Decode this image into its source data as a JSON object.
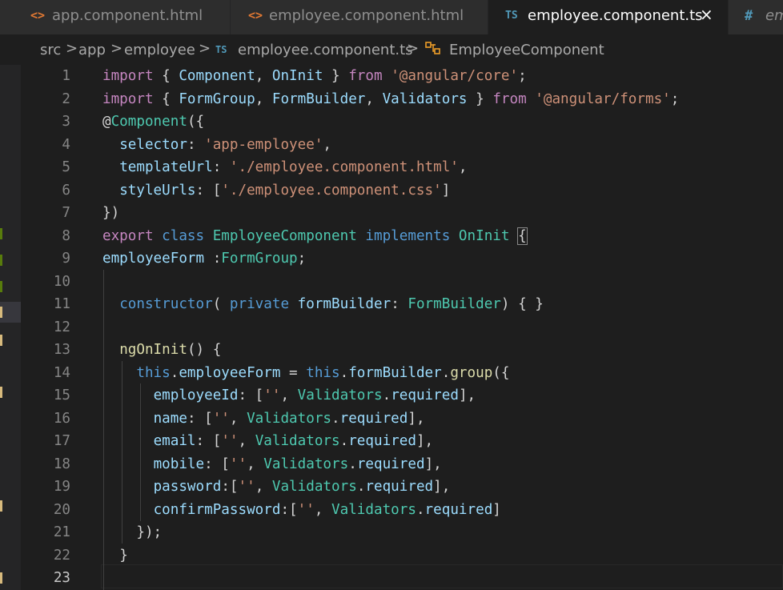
{
  "tabs": [
    {
      "icon": "<>",
      "label": "app.component.html",
      "active": false
    },
    {
      "icon": "<>",
      "label": "employee.component.html",
      "active": false
    },
    {
      "icon": "TS",
      "label": "employee.component.ts",
      "active": true,
      "close": "×"
    },
    {
      "icon": "#",
      "label": "em",
      "active": false
    }
  ],
  "breadcrumb": {
    "items": [
      "src",
      "app",
      "employee",
      "employee.component.ts",
      "EmployeeComponent"
    ],
    "file_icon": "TS",
    "separator": ">"
  },
  "editor": {
    "line_numbers": [
      "1",
      "2",
      "3",
      "4",
      "5",
      "6",
      "7",
      "8",
      "9",
      "10",
      "11",
      "12",
      "13",
      "14",
      "15",
      "16",
      "17",
      "18",
      "19",
      "20",
      "21",
      "22",
      "23"
    ],
    "current_line": "23",
    "code": {
      "l1": [
        "import",
        " { ",
        "Component",
        ", ",
        "OnInit",
        " } ",
        "from",
        " ",
        "'@angular/core'",
        ";"
      ],
      "l2": [
        "import",
        " { ",
        "FormGroup",
        ", ",
        "FormBuilder",
        ", ",
        "Validators",
        " } ",
        "from",
        " ",
        "'@angular/forms'",
        ";"
      ],
      "l3": [
        "@",
        "Component",
        "({"
      ],
      "l4": [
        "  ",
        "selector",
        ": ",
        "'app-employee'",
        ","
      ],
      "l5": [
        "  ",
        "templateUrl",
        ": ",
        "'./employee.component.html'",
        ","
      ],
      "l6": [
        "  ",
        "styleUrls",
        ": [",
        "'./employee.component.css'",
        "]"
      ],
      "l7": [
        "})"
      ],
      "l8": [
        "export",
        " ",
        "class",
        " ",
        "EmployeeComponent",
        " ",
        "implements",
        " ",
        "OnInit",
        " ",
        "{"
      ],
      "l9": [
        "employeeForm",
        " :",
        "FormGroup",
        ";"
      ],
      "l11": [
        "  ",
        "constructor",
        "( ",
        "private",
        " ",
        "formBuilder",
        ": ",
        "FormBuilder",
        ") { }"
      ],
      "l13": [
        "  ",
        "ngOnInit",
        "() {"
      ],
      "l14": [
        "    ",
        "this",
        ".",
        "employeeForm",
        " = ",
        "this",
        ".",
        "formBuilder",
        ".",
        "group",
        "({"
      ],
      "l15": [
        "      ",
        "employeeId",
        ": [",
        "''",
        ", ",
        "Validators",
        ".",
        "required",
        "],"
      ],
      "l16": [
        "      ",
        "name",
        ": [",
        "''",
        ", ",
        "Validators",
        ".",
        "required",
        "],"
      ],
      "l17": [
        "      ",
        "email",
        ": [",
        "''",
        ", ",
        "Validators",
        ".",
        "required",
        "],"
      ],
      "l18": [
        "      ",
        "mobile",
        ": [",
        "''",
        ", ",
        "Validators",
        ".",
        "required",
        "],"
      ],
      "l19": [
        "      ",
        "password",
        ":[",
        "''",
        ", ",
        "Validators",
        ".",
        "required",
        "],"
      ],
      "l20": [
        "      ",
        "confirmPassword",
        ":[",
        "''",
        ", ",
        "Validators",
        ".",
        "required",
        "]"
      ],
      "l21": [
        "    ",
        "});"
      ],
      "l22": [
        "  ",
        "}"
      ]
    }
  },
  "colors": {
    "keyword_control": "#c586c0",
    "keyword": "#569cd6",
    "type": "#4ec9b0",
    "identifier": "#9cdcfe",
    "string": "#ce9178",
    "function": "#dcdcaa",
    "html_icon": "#e37933",
    "ts_icon": "#519aba"
  }
}
